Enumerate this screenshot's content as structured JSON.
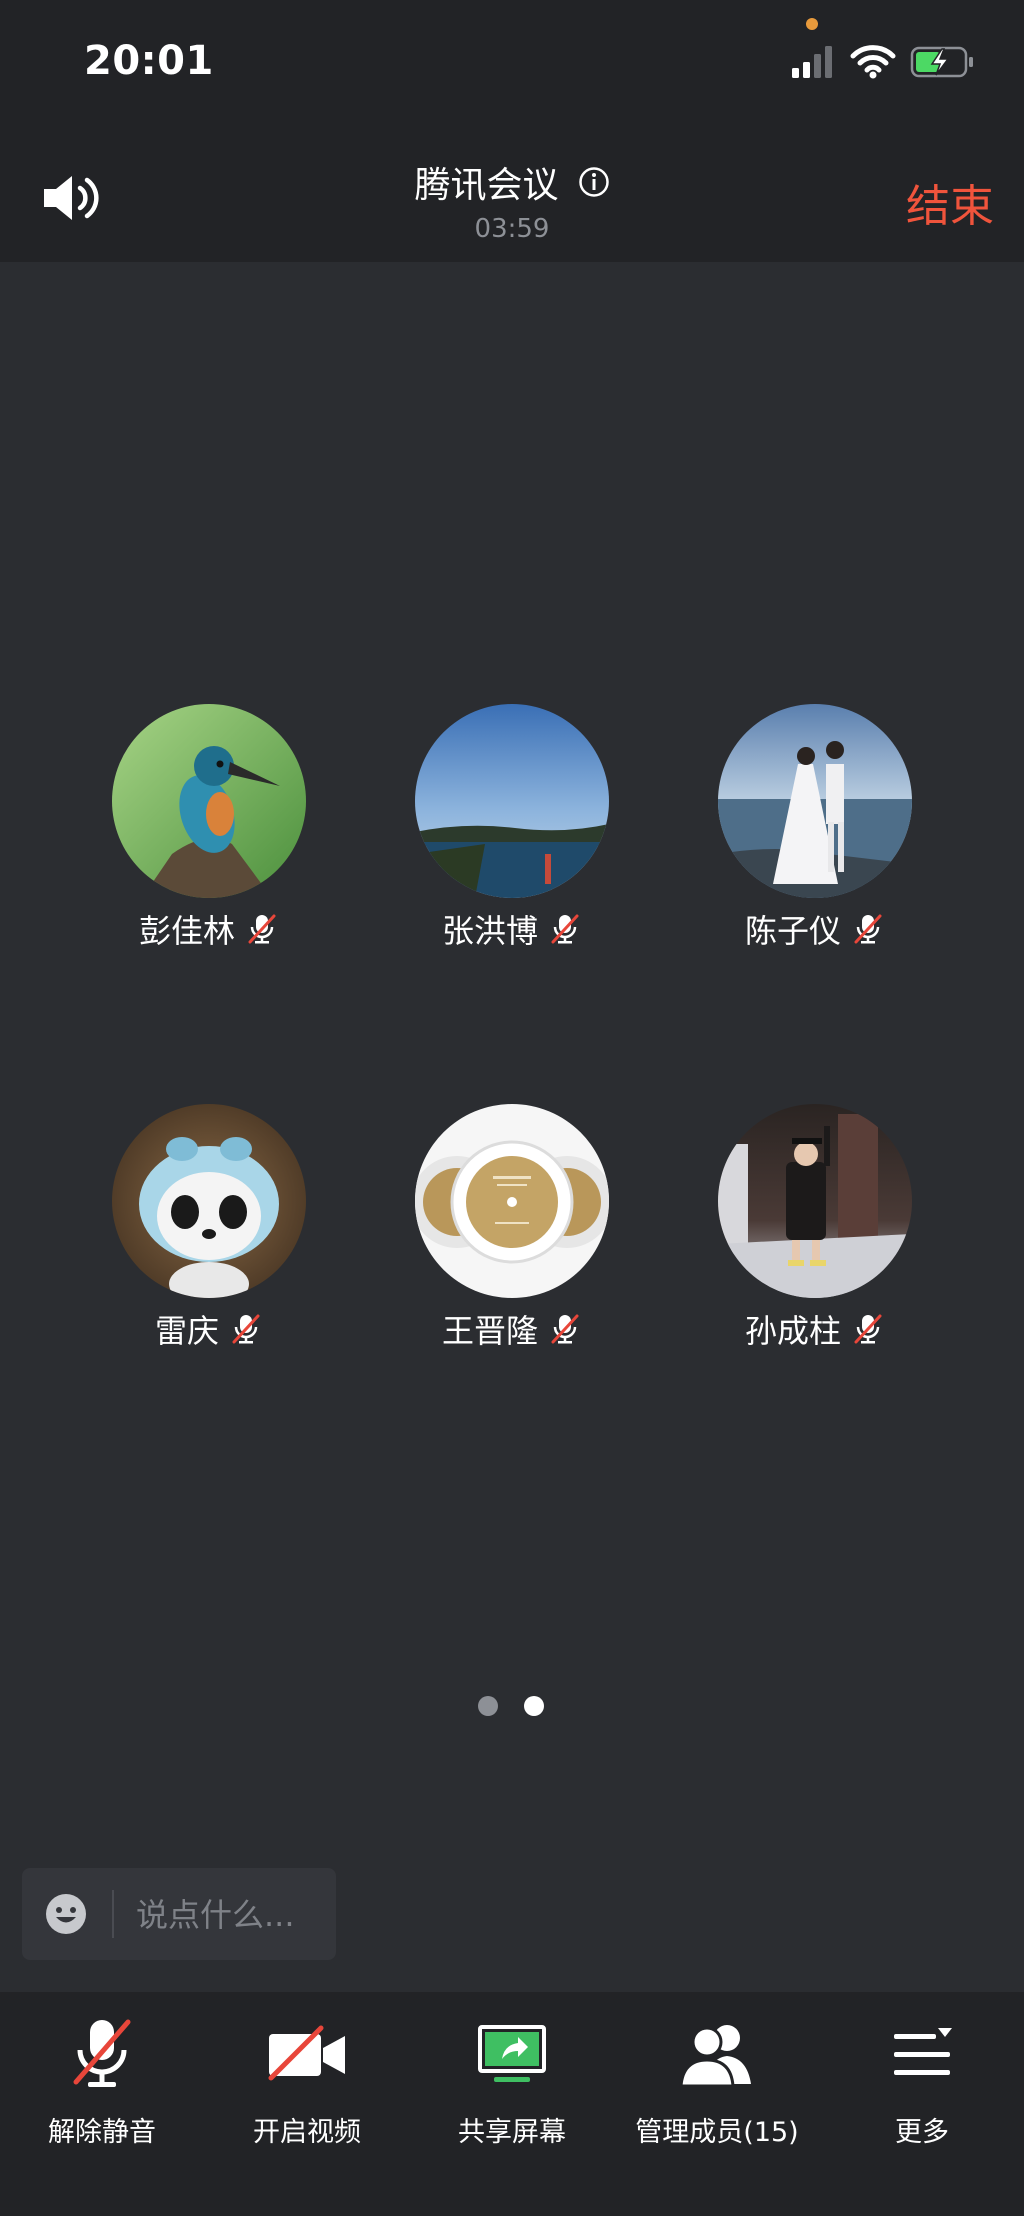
{
  "status_bar": {
    "time": "20:01"
  },
  "header": {
    "title": "腾讯会议",
    "duration": "03:59",
    "end_label": "结束"
  },
  "participants": [
    {
      "name": "彭佳林",
      "muted": true
    },
    {
      "name": "张洪博",
      "muted": true
    },
    {
      "name": "陈子仪",
      "muted": true
    },
    {
      "name": "雷庆",
      "muted": true
    },
    {
      "name": "王晋隆",
      "muted": true
    },
    {
      "name": "孙成柱",
      "muted": true
    }
  ],
  "pagination": {
    "total": 2,
    "current": 2
  },
  "chat": {
    "placeholder": "说点什么..."
  },
  "toolbar": {
    "unmute_label": "解除静音",
    "video_label": "开启视频",
    "share_label": "共享屏幕",
    "members_label": "管理成员(15)",
    "more_label": "更多"
  },
  "colors": {
    "end_red": "#f0543c",
    "mute_red": "#e8463a",
    "share_green": "#3fbf62",
    "battery_green": "#4cd964"
  }
}
